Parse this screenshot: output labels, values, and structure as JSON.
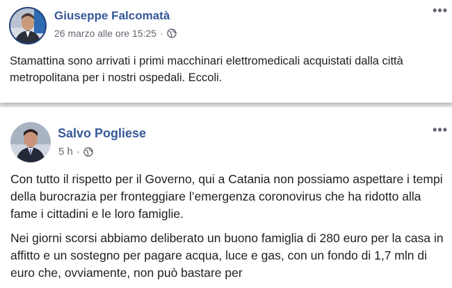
{
  "posts": [
    {
      "author": "Giuseppe Falcomatà",
      "timestamp": "26 marzo alle ore 15:25",
      "separator": "·",
      "privacy_icon": "globe-icon",
      "more_label": "•••",
      "paragraphs": [
        "Stamattina sono arrivati i primi macchinari elettromedicali acquistati dalla città metropolitana per i nostri ospedali. Eccoli."
      ]
    },
    {
      "author": "Salvo Pogliese",
      "timestamp": "5 h",
      "separator": "·",
      "privacy_icon": "globe-icon",
      "more_label": "•••",
      "paragraphs": [
        "Con tutto il rispetto per il Governo, qui a Catania non possiamo aspettare i tempi della burocrazia per fronteggiare l’emergenza coronovirus che ha ridotto alla fame i cittadini e le loro famiglie.",
        "Nei giorni scorsi abbiamo deliberato un buono famiglia di 280 euro per la casa in affitto e un sostegno per pagare acqua, luce e gas, con un fondo di 1,7 mln di euro che, ovviamente, non può bastare per"
      ]
    }
  ],
  "colors": {
    "author": "#365899",
    "meta": "#616770",
    "text": "#1c1e21",
    "background": "#e9ebee"
  }
}
